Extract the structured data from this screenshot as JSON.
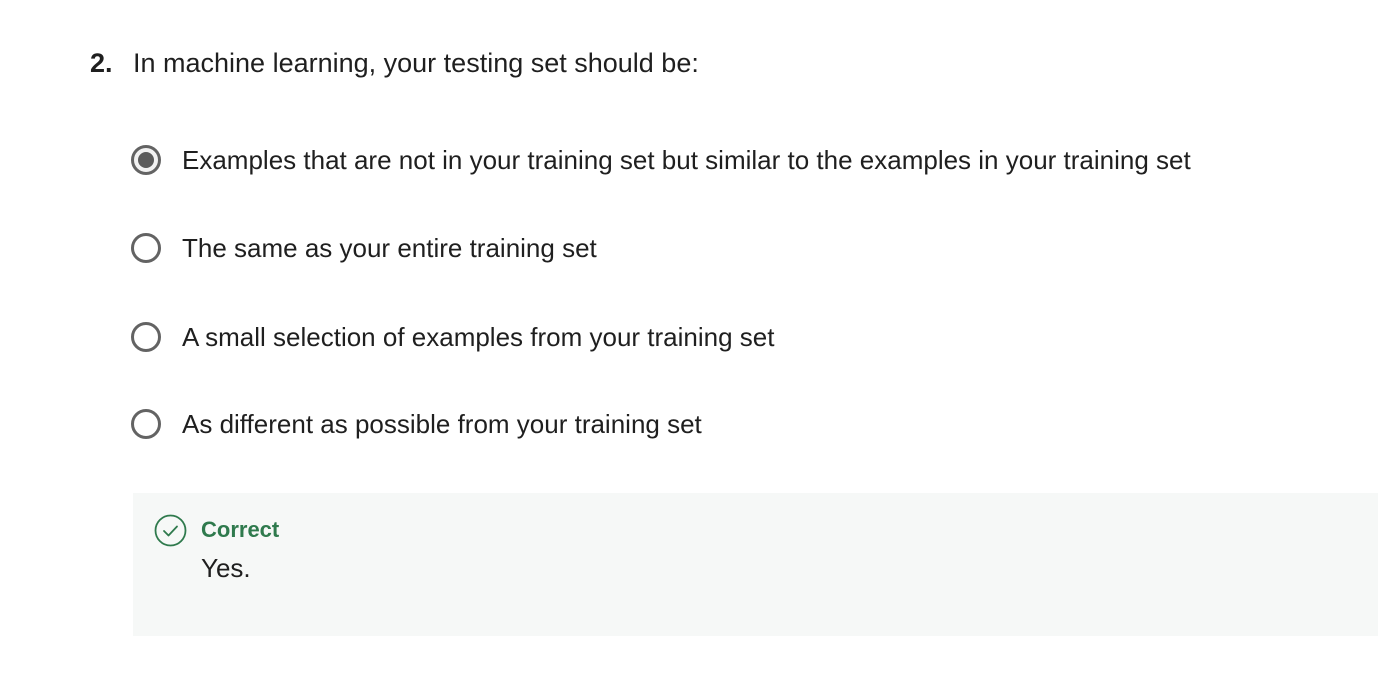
{
  "question": {
    "number": "2.",
    "text": "In machine learning, your testing set should be:"
  },
  "options": [
    {
      "label": "Examples that are not in your training set but similar to the examples in your training set",
      "selected": true
    },
    {
      "label": "The same as your entire training set",
      "selected": false
    },
    {
      "label": "A small selection of examples from your training set",
      "selected": false
    },
    {
      "label": "As different as possible from your training set",
      "selected": false
    }
  ],
  "feedback": {
    "status": "Correct",
    "message": "Yes.",
    "icon": "check-circle-icon",
    "status_color": "#2f7a4d",
    "background_color": "#f6f8f7"
  }
}
